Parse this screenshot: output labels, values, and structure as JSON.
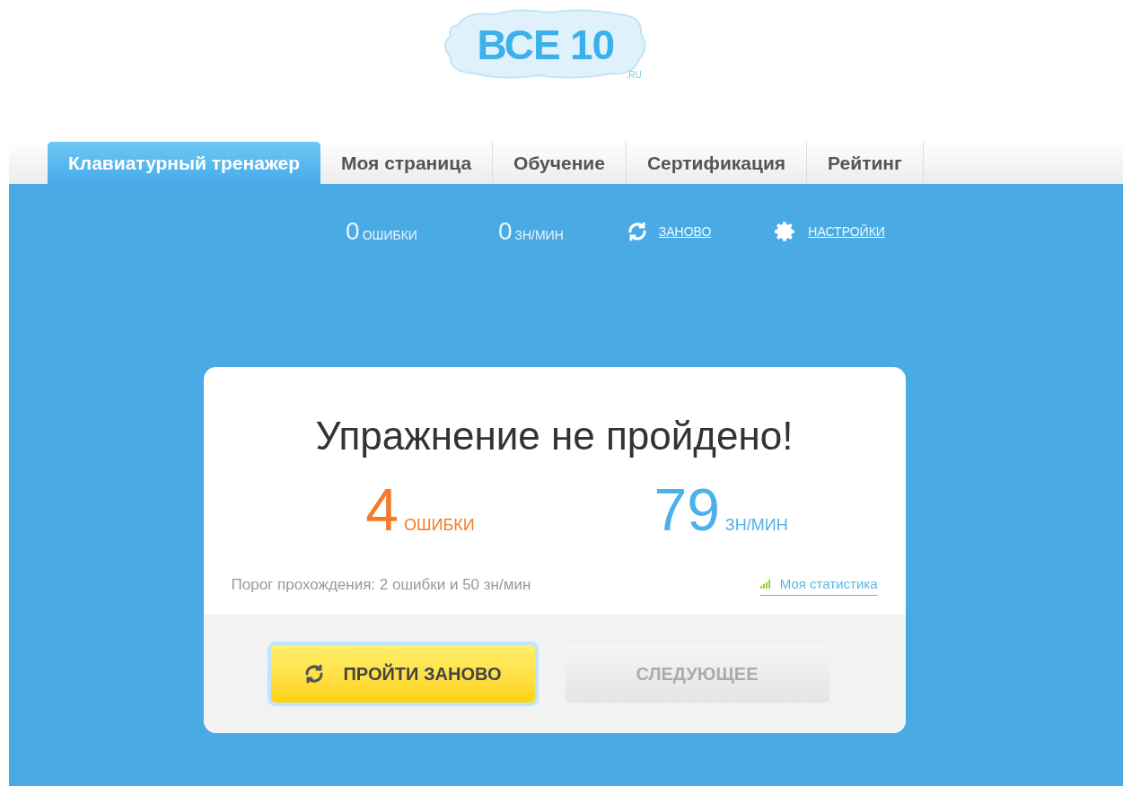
{
  "logo": {
    "text": "ВСЕ 10",
    "suffix": ".RU"
  },
  "tabs": [
    {
      "label": "Клавиатурный тренажер",
      "selected": true
    },
    {
      "label": "Моя страница",
      "selected": false
    },
    {
      "label": "Обучение",
      "selected": false
    },
    {
      "label": "Сертификация",
      "selected": false
    },
    {
      "label": "Рейтинг",
      "selected": false
    }
  ],
  "toolbar": {
    "errors": {
      "value": "0",
      "unit": "ОШИБКИ"
    },
    "speed": {
      "value": "0",
      "unit": "ЗН/МИН"
    },
    "restart_link": "ЗАНОВО",
    "settings_link": "НАСТРОЙКИ"
  },
  "result": {
    "title": "Упражнение не пройдено!",
    "errors": {
      "value": "4",
      "unit": "ОШИБКИ"
    },
    "speed": {
      "value": "79",
      "unit": "ЗН/МИН"
    },
    "threshold": "Порог прохождения: 2 ошибки и 50 зн/мин",
    "stats_link": "Моя статистика",
    "buttons": [
      {
        "kind": "retry",
        "label": "ПРОЙТИ ЗАНОВО",
        "disabled": false
      },
      {
        "kind": "next",
        "label": "СЛЕДУЮЩЕЕ",
        "disabled": true
      }
    ]
  }
}
